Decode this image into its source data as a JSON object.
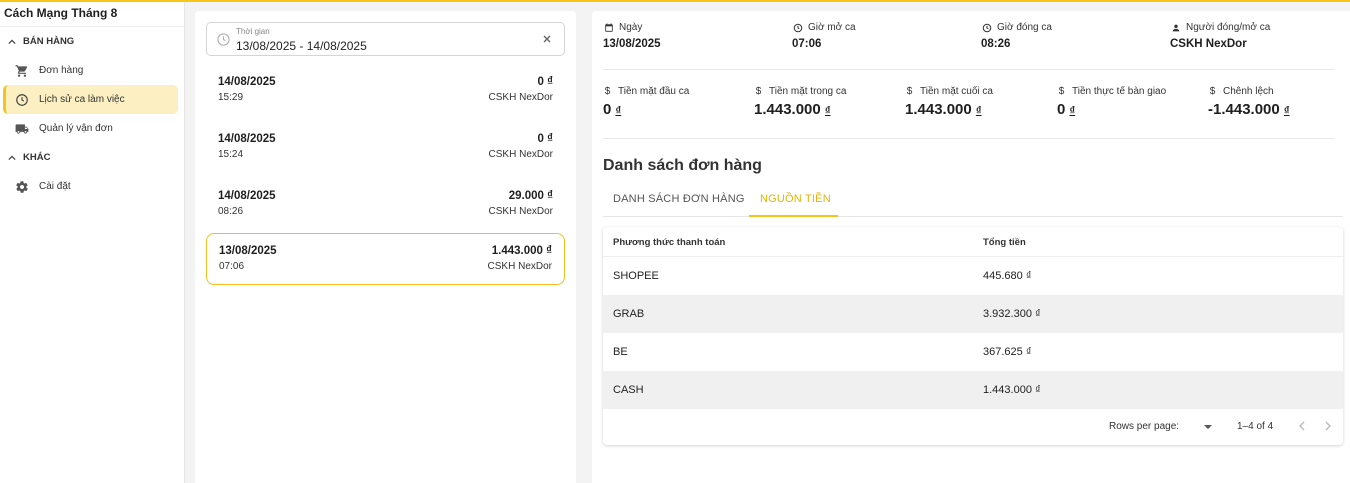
{
  "app": {
    "title": "Cách Mạng Tháng 8",
    "accent": "#f5c518"
  },
  "sidebar": {
    "sections": [
      {
        "label": "BÁN HÀNG",
        "items": [
          {
            "label": "Đơn hàng",
            "icon": "cart-icon"
          },
          {
            "label": "Lịch sử ca làm việc",
            "icon": "clock-icon",
            "active": true
          },
          {
            "label": "Quản lý vận đơn",
            "icon": "truck-icon"
          }
        ]
      },
      {
        "label": "KHÁC",
        "items": [
          {
            "label": "Cài đặt",
            "icon": "gear-icon"
          }
        ]
      }
    ]
  },
  "filter": {
    "label": "Thời gian",
    "value": "13/08/2025 - 14/08/2025"
  },
  "shifts": [
    {
      "date": "14/08/2025",
      "time": "15:29",
      "amount": "0 ₫",
      "user": "CSKH NexDor"
    },
    {
      "date": "14/08/2025",
      "time": "15:24",
      "amount": "0 ₫",
      "user": "CSKH NexDor"
    },
    {
      "date": "14/08/2025",
      "time": "08:26",
      "amount": "29.000 ₫",
      "user": "CSKH NexDor"
    },
    {
      "date": "13/08/2025",
      "time": "07:06",
      "amount": "1.443.000 ₫",
      "user": "CSKH NexDor",
      "selected": true
    }
  ],
  "detail": {
    "info": [
      {
        "label": "Ngày",
        "value": "13/08/2025",
        "icon": "calendar-icon"
      },
      {
        "label": "Giờ mở ca",
        "value": "07:06",
        "icon": "clock-icon"
      },
      {
        "label": "Giờ đóng ca",
        "value": "08:26",
        "icon": "clock-icon"
      },
      {
        "label": "Người đóng/mở ca",
        "value": "CSKH NexDor",
        "icon": "person-icon"
      }
    ],
    "cash": [
      {
        "label": "Tiền mặt đầu ca",
        "value": "0",
        "currency": "₫"
      },
      {
        "label": "Tiền mặt trong ca",
        "value": "1.443.000",
        "currency": "₫"
      },
      {
        "label": "Tiền mặt cuối ca",
        "value": "1.443.000",
        "currency": "₫"
      },
      {
        "label": "Tiền thực tế bàn giao",
        "value": "0",
        "currency": "₫"
      },
      {
        "label": "Chênh lệch",
        "value": "-1.443.000",
        "currency": "₫"
      }
    ],
    "cash_symbol": "$",
    "orders_title": "Danh sách đơn hàng",
    "tabs": [
      {
        "label": "DANH SÁCH ĐƠN HÀNG"
      },
      {
        "label": "NGUỒN TIỀN",
        "active": true
      }
    ],
    "table": {
      "headers": [
        "Phương thức thanh toán",
        "Tổng tiền"
      ],
      "rows": [
        [
          "SHOPEE",
          "445.680 ₫"
        ],
        [
          "GRAB",
          "3.932.300 ₫"
        ],
        [
          "BE",
          "367.625 ₫"
        ],
        [
          "CASH",
          "1.443.000 ₫"
        ]
      ]
    },
    "pager": {
      "rows_per_page_label": "Rows per page:",
      "range": "1–4 of 4"
    }
  }
}
